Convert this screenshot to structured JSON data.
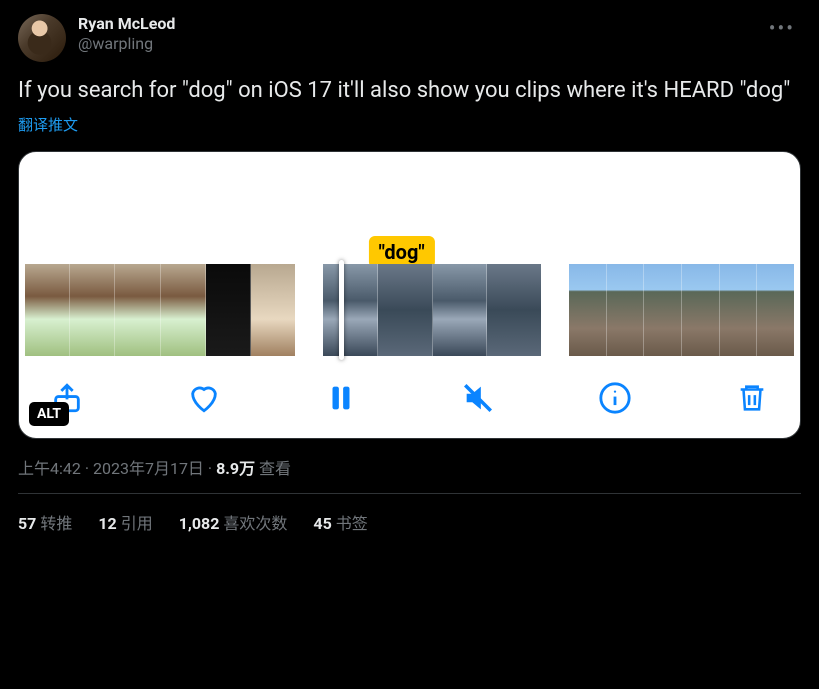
{
  "author": {
    "display_name": "Ryan McLeod",
    "handle": "@warpling"
  },
  "tweet_text": "If you search for \"dog\" on iOS 17 it'll also show you clips where it's HEARD \"dog\"",
  "translate_label": "翻译推文",
  "media": {
    "marker_label": "\"dog\"",
    "alt_badge": "ALT"
  },
  "meta": {
    "time": "上午4:42",
    "date": "2023年7月17日",
    "views_count": "8.9万",
    "views_label": "查看",
    "separator": " · "
  },
  "stats": {
    "retweets_count": "57",
    "retweets_label": "转推",
    "quotes_count": "12",
    "quotes_label": "引用",
    "likes_count": "1,082",
    "likes_label": "喜欢次数",
    "bookmarks_count": "45",
    "bookmarks_label": "书签"
  }
}
